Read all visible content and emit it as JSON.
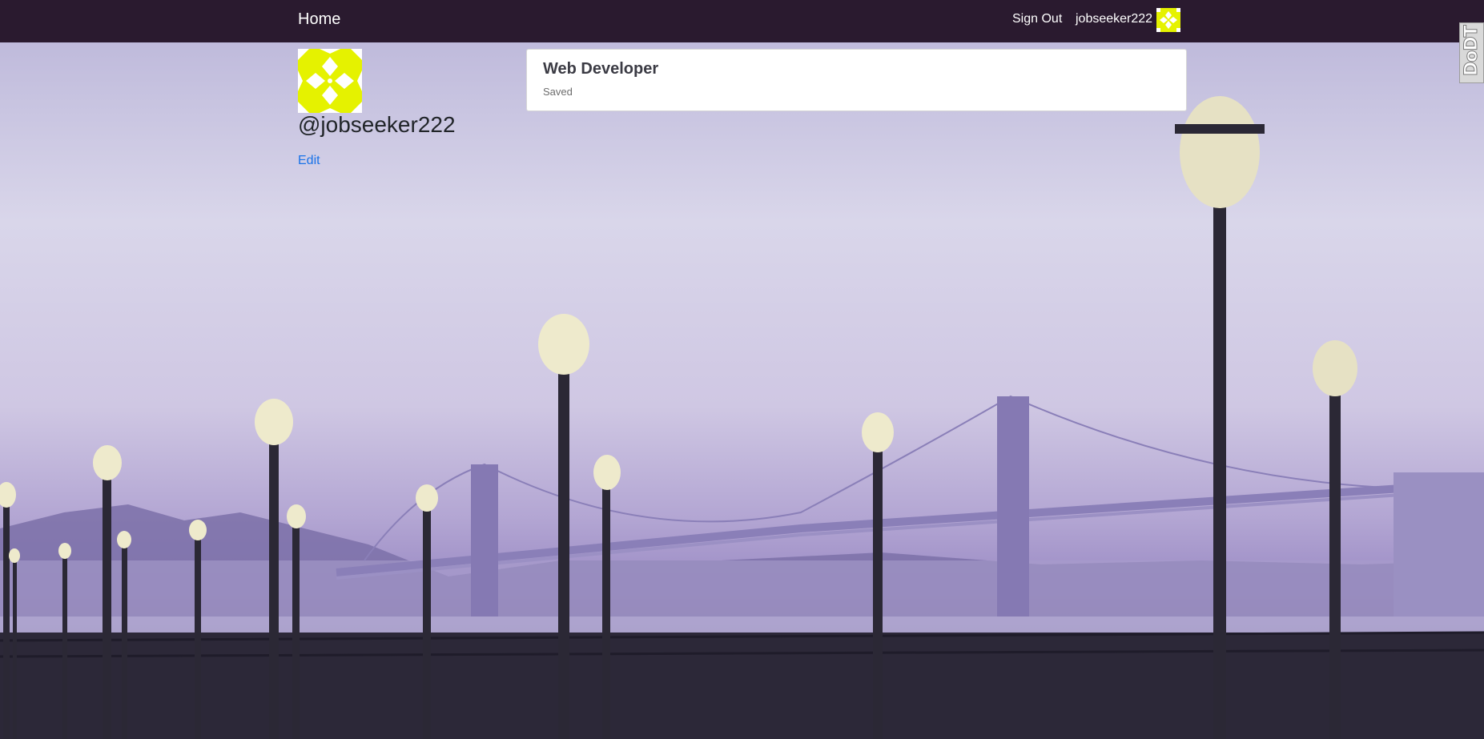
{
  "navbar": {
    "home_label": "Home",
    "signout_label": "Sign Out",
    "username": "jobseeker222",
    "avatar_icon": "identicon-yellow",
    "background_color": "#2a1a2f"
  },
  "profile": {
    "avatar_icon": "identicon-yellow",
    "handle": "@jobseeker222",
    "edit_label": "Edit",
    "avatar_color": "#e5f200"
  },
  "saved_jobs": [
    {
      "title": "Web Developer",
      "status": "Saved"
    }
  ],
  "extension_tab": {
    "label": "DoDT"
  },
  "colors": {
    "link": "#1a73e8",
    "identicon": "#e5f200"
  }
}
